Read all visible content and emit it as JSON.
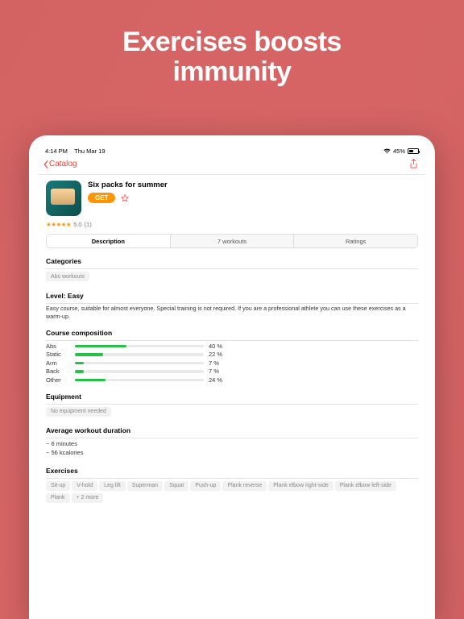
{
  "marketing": {
    "headline_l1": "Exercises boosts",
    "headline_l2": "immunity"
  },
  "statusbar": {
    "time": "4:14 PM",
    "date": "Thu Mar 19",
    "battery_pct": "45%"
  },
  "nav": {
    "back_label": "Catalog"
  },
  "course": {
    "title": "Six packs for summer",
    "get_label": "GET",
    "rating_value": "5.0",
    "rating_count": "(1)"
  },
  "tabs": {
    "description": "Description",
    "workouts": "7 workouts",
    "ratings": "Ratings"
  },
  "sections": {
    "categories_title": "Categories",
    "categories_chip": "Abs workouts",
    "level_title": "Level: Easy",
    "level_desc": "Easy course, suitable for almost everyone. Special training is not required. If you are a professional athlete you can use these exercises as a warm-up.",
    "composition_title": "Course composition",
    "equipment_title": "Equipment",
    "equipment_chip": "No equipment needed",
    "duration_title": "Average workout duration",
    "duration_l1": "~ 6 minutes",
    "duration_l2": "~ 56 kcalories",
    "exercises_title": "Exercises",
    "more_chip": "+ 2 more"
  },
  "composition": [
    {
      "label": "Abs",
      "pct": 40,
      "pct_label": "40 %"
    },
    {
      "label": "Static",
      "pct": 22,
      "pct_label": "22 %"
    },
    {
      "label": "Arm",
      "pct": 7,
      "pct_label": "7 %"
    },
    {
      "label": "Back",
      "pct": 7,
      "pct_label": "7 %"
    },
    {
      "label": "Other",
      "pct": 24,
      "pct_label": "24 %"
    }
  ],
  "exercises": [
    "Sit-up",
    "V-hold",
    "Leg lift",
    "Superman",
    "Squat",
    "Push-up",
    "Plank reverse",
    "Plank elbow right-side",
    "Plank elbow left-side",
    "Plank"
  ]
}
